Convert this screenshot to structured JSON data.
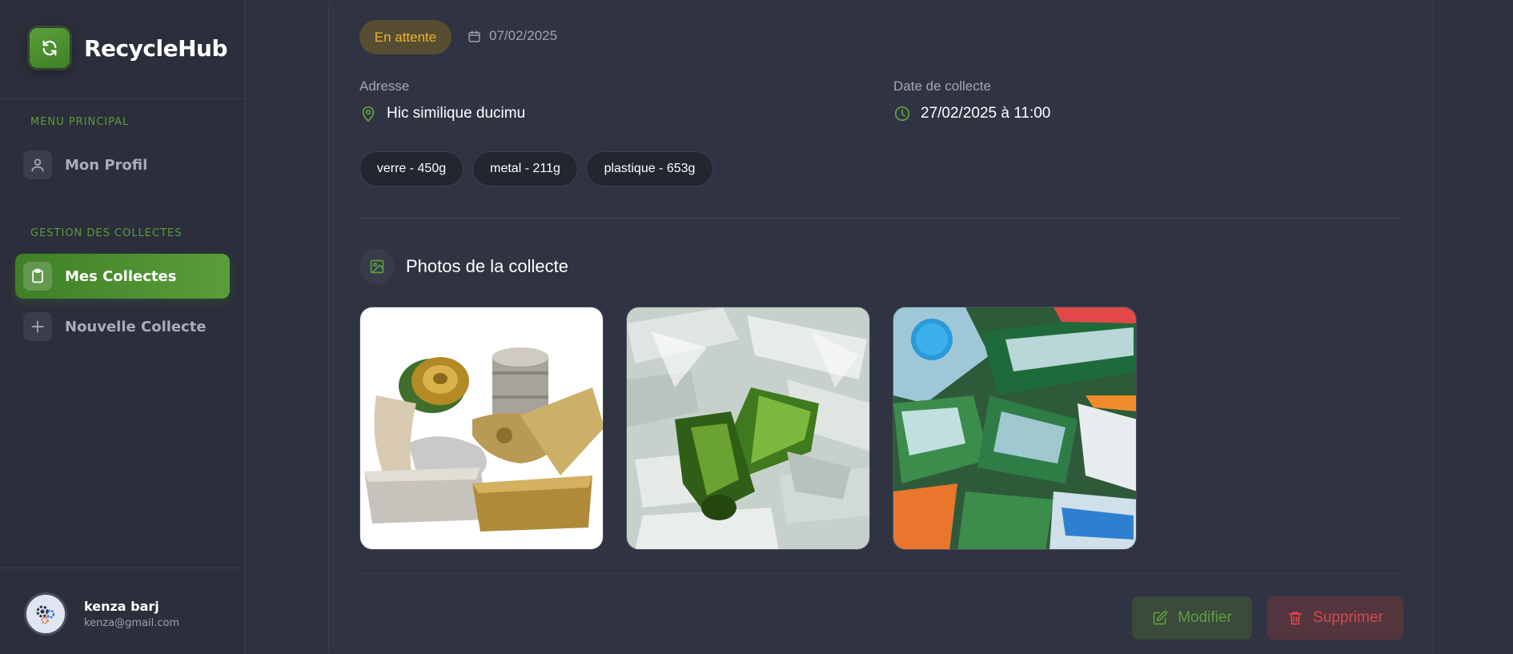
{
  "app": {
    "name": "RecycleHub"
  },
  "sidebar": {
    "section_main": "MENU PRINCIPAL",
    "section_collectes": "GESTION DES COLLECTES",
    "items": [
      {
        "label": "Mon Profil",
        "icon": "user-icon",
        "active": false
      },
      {
        "label": "Mes Collectes",
        "icon": "clipboard-icon",
        "active": true
      },
      {
        "label": "Nouvelle Collecte",
        "icon": "plus-icon",
        "active": false
      }
    ],
    "user": {
      "name": "kenza barj",
      "email": "kenza@gmail.com"
    }
  },
  "collecte": {
    "status": "En attente",
    "created_date": "07/02/2025",
    "address_label": "Adresse",
    "address": "Hic similique ducimu",
    "date_label": "Date de collecte",
    "date": "27/02/2025 à 11:00",
    "materials": [
      "verre - 450g",
      "metal - 211g",
      "plastique - 653g"
    ],
    "photos_title": "Photos de la collecte",
    "photos": [
      {
        "icon": "metal-cans-photo"
      },
      {
        "icon": "glass-bottles-photo"
      },
      {
        "icon": "plastic-bottles-photo"
      }
    ],
    "actions": {
      "edit": "Modifier",
      "delete": "Supprimer"
    }
  },
  "colors": {
    "accent": "#4f9433",
    "status_pending": "#e8b52c",
    "danger": "#d9474f"
  }
}
